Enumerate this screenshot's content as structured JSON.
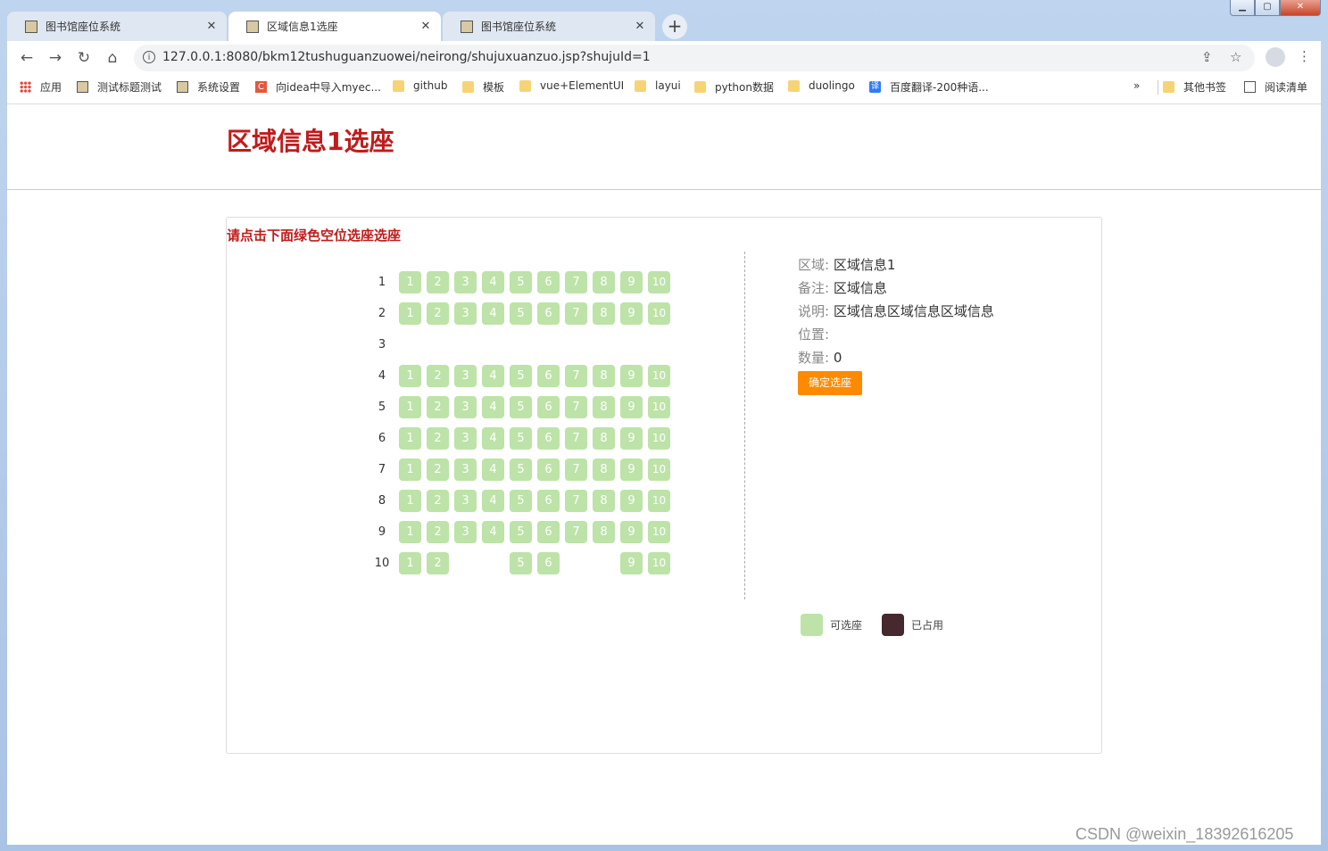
{
  "browser": {
    "tabs": [
      {
        "label": "图书馆座位系统",
        "active": false
      },
      {
        "label": "区域信息1选座",
        "active": true
      },
      {
        "label": "图书馆座位系统",
        "active": false
      }
    ],
    "url": "127.0.0.1:8080/bkm12tushuguanzuowei/neirong/shujuxuanzuo.jsp?shujuId=1",
    "bookmarks": [
      "应用",
      "测试标题测试",
      "系统设置",
      "向idea中导入myec...",
      "github",
      "模板",
      "vue+ElementUI",
      "layui",
      "python数据",
      "duolingo",
      "百度翻译-200种语..."
    ],
    "bookmarks_overflow": "»",
    "bookmarks_right": [
      "其他书签",
      "阅读清单"
    ]
  },
  "page": {
    "title": "区域信息1选座",
    "tip": "请点击下面绿色空位选座选座",
    "rows": [
      {
        "label": "1",
        "seats": [
          "1",
          "2",
          "3",
          "4",
          "5",
          "6",
          "7",
          "8",
          "9",
          "10"
        ]
      },
      {
        "label": "2",
        "seats": [
          "1",
          "2",
          "3",
          "4",
          "5",
          "6",
          "7",
          "8",
          "9",
          "10"
        ]
      },
      {
        "label": "3",
        "seats": []
      },
      {
        "label": "4",
        "seats": [
          "1",
          "2",
          "3",
          "4",
          "5",
          "6",
          "7",
          "8",
          "9",
          "10"
        ]
      },
      {
        "label": "5",
        "seats": [
          "1",
          "2",
          "3",
          "4",
          "5",
          "6",
          "7",
          "8",
          "9",
          "10"
        ]
      },
      {
        "label": "6",
        "seats": [
          "1",
          "2",
          "3",
          "4",
          "5",
          "6",
          "7",
          "8",
          "9",
          "10"
        ]
      },
      {
        "label": "7",
        "seats": [
          "1",
          "2",
          "3",
          "4",
          "5",
          "6",
          "7",
          "8",
          "9",
          "10"
        ]
      },
      {
        "label": "8",
        "seats": [
          "1",
          "2",
          "3",
          "4",
          "5",
          "6",
          "7",
          "8",
          "9",
          "10"
        ]
      },
      {
        "label": "9",
        "seats": [
          "1",
          "2",
          "3",
          "4",
          "5",
          "6",
          "7",
          "8",
          "9",
          "10"
        ]
      },
      {
        "label": "10",
        "seats": [
          "1",
          "2",
          "5",
          "6",
          "9",
          "10"
        ]
      }
    ],
    "info": {
      "area_label": "区域:",
      "area_value": "区域信息1",
      "note_label": "备注:",
      "note_value": "区域信息",
      "desc_label": "说明:",
      "desc_value": "区域信息区域信息区域信息",
      "position_label": "位置:",
      "position_value": "",
      "count_label": "数量:",
      "count_value": "0",
      "confirm_button": "确定选座"
    },
    "legend": {
      "available": "可选座",
      "occupied": "已占用"
    },
    "colors": {
      "available": "#bde3a8",
      "occupied": "#46282f",
      "accent": "#c01c1c",
      "button": "#ff8a00"
    }
  },
  "watermark": "CSDN @weixin_18392616205"
}
